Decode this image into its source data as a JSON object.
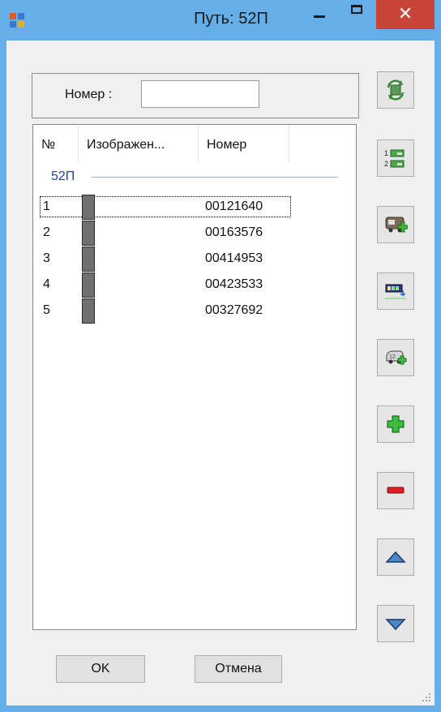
{
  "window": {
    "title": "Путь: 52П",
    "close_glyph": "✕"
  },
  "search": {
    "label": "Номер :",
    "value": ""
  },
  "list": {
    "columns": [
      "№",
      "Изображен...",
      "Номер"
    ],
    "group_label": "52П",
    "rows": [
      {
        "num": "1",
        "number": "00121640"
      },
      {
        "num": "2",
        "number": "00163576"
      },
      {
        "num": "3",
        "number": "00414953"
      },
      {
        "num": "4",
        "number": "00423533"
      },
      {
        "num": "5",
        "number": "00327692"
      }
    ]
  },
  "buttons": {
    "ok": "OK",
    "cancel": "Отмена"
  },
  "side_icons": [
    "refresh-icon",
    "renumber-icon",
    "add-wagon-icon",
    "wagon-move-icon",
    "add-car-icon",
    "plus-icon",
    "minus-icon",
    "up-arrow-icon",
    "down-arrow-icon"
  ],
  "colors": {
    "titlebar": "#66aee8",
    "close": "#c64439",
    "group": "#1e3fa0",
    "plus": "#3dbb3d",
    "minus": "#e02020",
    "arrow": "#4a86c8"
  }
}
